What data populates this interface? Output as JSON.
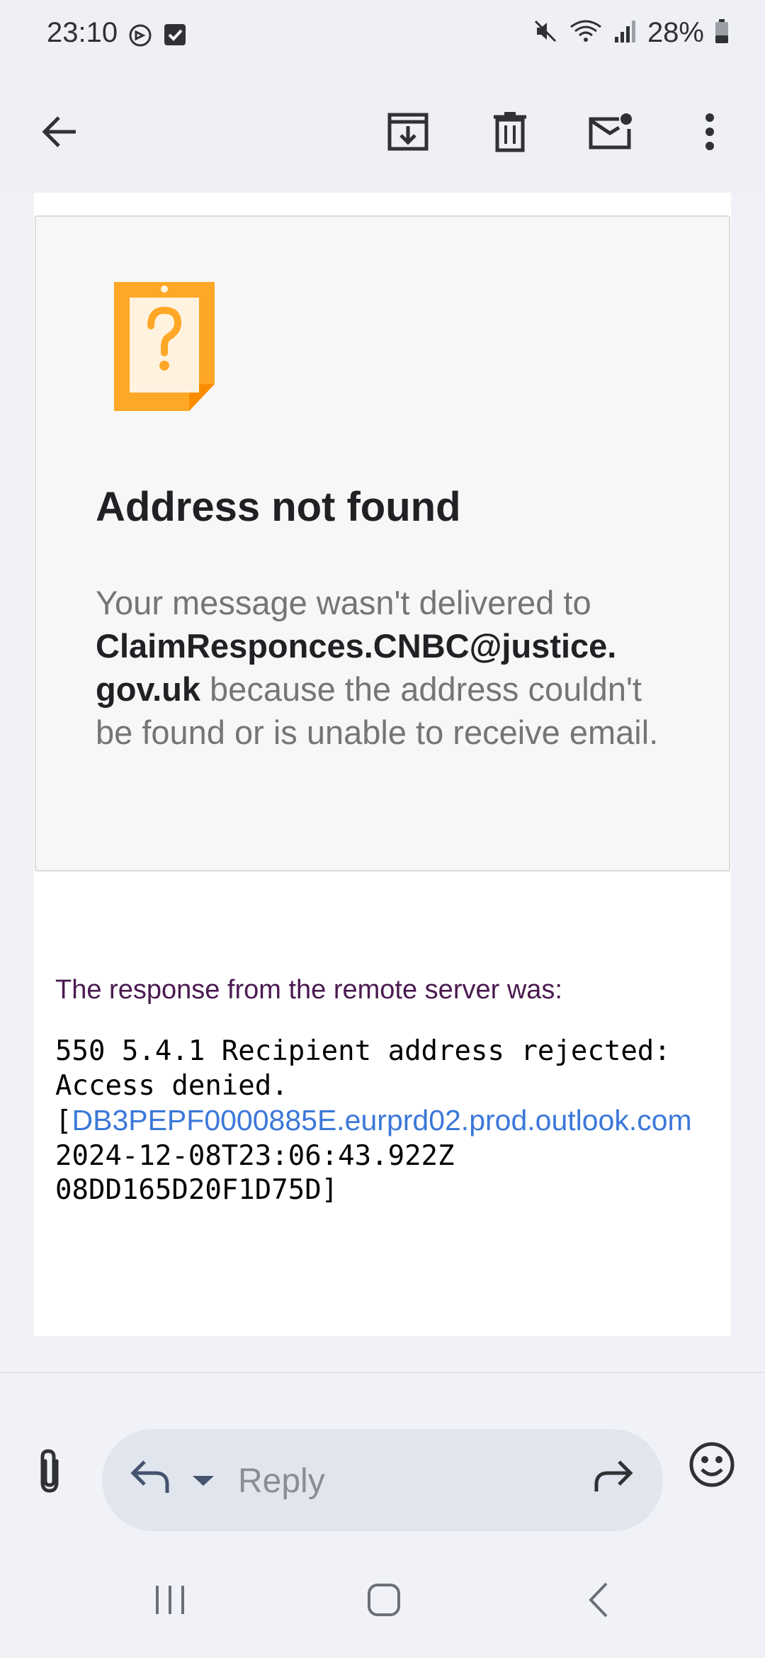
{
  "status_bar": {
    "time": "23:10",
    "battery": "28%",
    "icons": [
      "notification-icon",
      "checkbox-icon",
      "mute-icon",
      "wifi-icon",
      "signal-icon",
      "battery-icon"
    ]
  },
  "toolbar": {
    "icons": [
      "back-arrow-icon",
      "archive-icon",
      "delete-icon",
      "mark-unread-icon",
      "more-options-icon"
    ]
  },
  "card": {
    "title": "Address not found",
    "body_prefix": "Your message wasn't delivered to ",
    "address_line1": "ClaimResponces.CNBC@justice.",
    "address_line2": "gov.uk",
    "body_suffix": " because the address couldn't be found or is unable to receive email."
  },
  "remote": {
    "label": "The response from the remote server was:",
    "line1": "550 5.4.1 Recipient address rejected:",
    "line2": "Access denied.",
    "line3_prefix": "[",
    "link": "DB3PEPF0000885E.eurprd02.prod.outlook.com",
    "line4": "2024-12-08T23:06:43.922Z",
    "line5": "08DD165D20F1D75D]"
  },
  "reply_bar": {
    "placeholder": "Reply"
  },
  "colors": {
    "accent_orange": "#ffa726",
    "link_blue": "#3b78d9",
    "label_purple": "#4a1a4f"
  }
}
